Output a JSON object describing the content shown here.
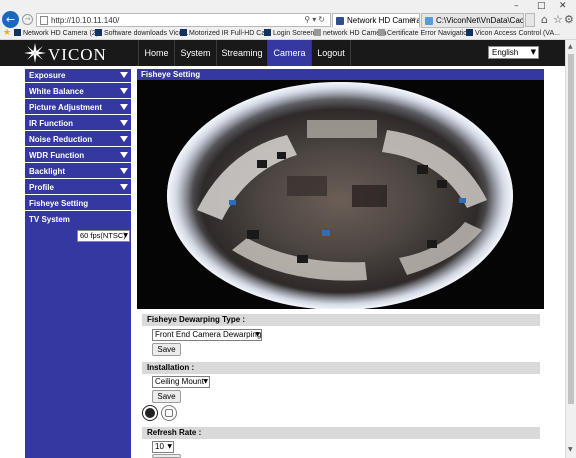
{
  "browser": {
    "url": "http://10.10.11.140/",
    "tabs": [
      {
        "label": "Network HD Camera",
        "active": true
      },
      {
        "label": "C:\\ViconNet\\VnData\\Cach...",
        "active": false
      }
    ],
    "favorites": [
      "Network HD Camera (2)",
      "Software downloads Vico...",
      "Motorized IR Full-HD Ca...",
      "Login Screen",
      "network HD Camera",
      "Certificate Error Navigatio...",
      "Vicon Access Control (VA..."
    ]
  },
  "header": {
    "brand": "VICON",
    "nav": [
      "Home",
      "System",
      "Streaming",
      "Camera",
      "Logout"
    ],
    "active_nav": "Camera",
    "language": "English"
  },
  "sidebar": {
    "items": [
      {
        "label": "Exposure",
        "expandable": true
      },
      {
        "label": "White Balance",
        "expandable": true
      },
      {
        "label": "Picture Adjustment",
        "expandable": true
      },
      {
        "label": "IR Function",
        "expandable": true
      },
      {
        "label": "Noise Reduction",
        "expandable": true
      },
      {
        "label": "WDR Function",
        "expandable": true
      },
      {
        "label": "Backlight",
        "expandable": true
      },
      {
        "label": "Profile",
        "expandable": true
      },
      {
        "label": "Fisheye Setting",
        "expandable": false
      },
      {
        "label": "TV System",
        "expandable": false
      }
    ],
    "tv_system_value": "60 fps(NTSC)"
  },
  "main": {
    "title": "Fisheye Setting",
    "dewarp": {
      "label": "Fisheye Dewarping Type :",
      "value": "Front End Camera Dewarping",
      "save": "Save"
    },
    "installation": {
      "label": "Installation :",
      "value": "Ceiling Mount",
      "save": "Save"
    },
    "refresh": {
      "label": "Refresh Rate :",
      "value": "10",
      "save": "Save"
    }
  },
  "colors": {
    "accent": "#3438a0",
    "header_bg": "#191919",
    "row_bg": "#d9d9d9"
  }
}
